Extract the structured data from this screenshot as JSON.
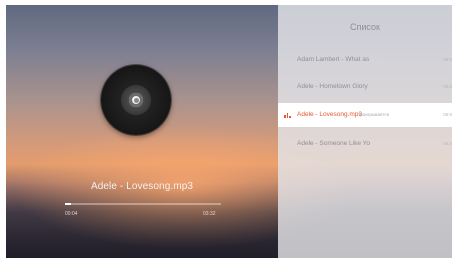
{
  "player": {
    "track_title": "Adele - Lovesong.mp3",
    "time_elapsed": "00:04",
    "time_total": "03:32",
    "progress": 0.04
  },
  "playlist": {
    "title": "Список",
    "items": [
      {
        "name": "Adam Lambert - What as",
        "status": "",
        "duration": "05:0",
        "active": false
      },
      {
        "name": "Adele - Hometown Glory",
        "status": "",
        "duration": "05:0",
        "active": false
      },
      {
        "name": "Adele - Lovesong.mp3",
        "status": "Проигрывается",
        "duration": "05:5",
        "active": true
      },
      {
        "name": "Adele - Someone Like Yo",
        "status": "",
        "duration": "04:4",
        "active": false
      }
    ]
  },
  "colors": {
    "accent": "#e8572f",
    "panel": "#e4e4e8",
    "muted_text": "#8f8f99"
  },
  "icons": {
    "disc": "vinyl-disc-icon",
    "playing": "playing-bars-icon"
  }
}
